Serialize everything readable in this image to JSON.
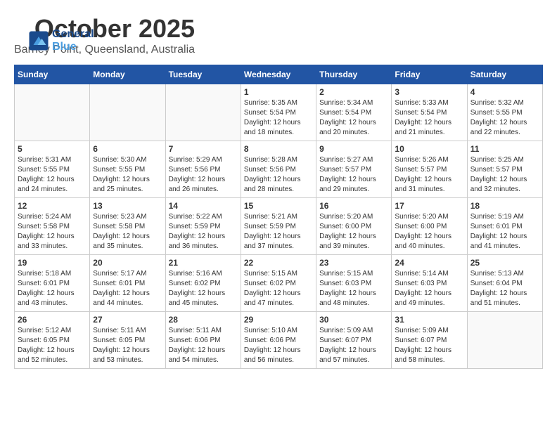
{
  "header": {
    "month_year": "October 2025",
    "location": "Barney Point, Queensland, Australia",
    "logo_line1": "General",
    "logo_line2": "Blue"
  },
  "weekdays": [
    "Sunday",
    "Monday",
    "Tuesday",
    "Wednesday",
    "Thursday",
    "Friday",
    "Saturday"
  ],
  "weeks": [
    [
      {
        "day": "",
        "sunrise": "",
        "sunset": "",
        "daylight": ""
      },
      {
        "day": "",
        "sunrise": "",
        "sunset": "",
        "daylight": ""
      },
      {
        "day": "",
        "sunrise": "",
        "sunset": "",
        "daylight": ""
      },
      {
        "day": "1",
        "sunrise": "Sunrise: 5:35 AM",
        "sunset": "Sunset: 5:54 PM",
        "daylight": "Daylight: 12 hours and 18 minutes."
      },
      {
        "day": "2",
        "sunrise": "Sunrise: 5:34 AM",
        "sunset": "Sunset: 5:54 PM",
        "daylight": "Daylight: 12 hours and 20 minutes."
      },
      {
        "day": "3",
        "sunrise": "Sunrise: 5:33 AM",
        "sunset": "Sunset: 5:54 PM",
        "daylight": "Daylight: 12 hours and 21 minutes."
      },
      {
        "day": "4",
        "sunrise": "Sunrise: 5:32 AM",
        "sunset": "Sunset: 5:55 PM",
        "daylight": "Daylight: 12 hours and 22 minutes."
      }
    ],
    [
      {
        "day": "5",
        "sunrise": "Sunrise: 5:31 AM",
        "sunset": "Sunset: 5:55 PM",
        "daylight": "Daylight: 12 hours and 24 minutes."
      },
      {
        "day": "6",
        "sunrise": "Sunrise: 5:30 AM",
        "sunset": "Sunset: 5:55 PM",
        "daylight": "Daylight: 12 hours and 25 minutes."
      },
      {
        "day": "7",
        "sunrise": "Sunrise: 5:29 AM",
        "sunset": "Sunset: 5:56 PM",
        "daylight": "Daylight: 12 hours and 26 minutes."
      },
      {
        "day": "8",
        "sunrise": "Sunrise: 5:28 AM",
        "sunset": "Sunset: 5:56 PM",
        "daylight": "Daylight: 12 hours and 28 minutes."
      },
      {
        "day": "9",
        "sunrise": "Sunrise: 5:27 AM",
        "sunset": "Sunset: 5:57 PM",
        "daylight": "Daylight: 12 hours and 29 minutes."
      },
      {
        "day": "10",
        "sunrise": "Sunrise: 5:26 AM",
        "sunset": "Sunset: 5:57 PM",
        "daylight": "Daylight: 12 hours and 31 minutes."
      },
      {
        "day": "11",
        "sunrise": "Sunrise: 5:25 AM",
        "sunset": "Sunset: 5:57 PM",
        "daylight": "Daylight: 12 hours and 32 minutes."
      }
    ],
    [
      {
        "day": "12",
        "sunrise": "Sunrise: 5:24 AM",
        "sunset": "Sunset: 5:58 PM",
        "daylight": "Daylight: 12 hours and 33 minutes."
      },
      {
        "day": "13",
        "sunrise": "Sunrise: 5:23 AM",
        "sunset": "Sunset: 5:58 PM",
        "daylight": "Daylight: 12 hours and 35 minutes."
      },
      {
        "day": "14",
        "sunrise": "Sunrise: 5:22 AM",
        "sunset": "Sunset: 5:59 PM",
        "daylight": "Daylight: 12 hours and 36 minutes."
      },
      {
        "day": "15",
        "sunrise": "Sunrise: 5:21 AM",
        "sunset": "Sunset: 5:59 PM",
        "daylight": "Daylight: 12 hours and 37 minutes."
      },
      {
        "day": "16",
        "sunrise": "Sunrise: 5:20 AM",
        "sunset": "Sunset: 6:00 PM",
        "daylight": "Daylight: 12 hours and 39 minutes."
      },
      {
        "day": "17",
        "sunrise": "Sunrise: 5:20 AM",
        "sunset": "Sunset: 6:00 PM",
        "daylight": "Daylight: 12 hours and 40 minutes."
      },
      {
        "day": "18",
        "sunrise": "Sunrise: 5:19 AM",
        "sunset": "Sunset: 6:01 PM",
        "daylight": "Daylight: 12 hours and 41 minutes."
      }
    ],
    [
      {
        "day": "19",
        "sunrise": "Sunrise: 5:18 AM",
        "sunset": "Sunset: 6:01 PM",
        "daylight": "Daylight: 12 hours and 43 minutes."
      },
      {
        "day": "20",
        "sunrise": "Sunrise: 5:17 AM",
        "sunset": "Sunset: 6:01 PM",
        "daylight": "Daylight: 12 hours and 44 minutes."
      },
      {
        "day": "21",
        "sunrise": "Sunrise: 5:16 AM",
        "sunset": "Sunset: 6:02 PM",
        "daylight": "Daylight: 12 hours and 45 minutes."
      },
      {
        "day": "22",
        "sunrise": "Sunrise: 5:15 AM",
        "sunset": "Sunset: 6:02 PM",
        "daylight": "Daylight: 12 hours and 47 minutes."
      },
      {
        "day": "23",
        "sunrise": "Sunrise: 5:15 AM",
        "sunset": "Sunset: 6:03 PM",
        "daylight": "Daylight: 12 hours and 48 minutes."
      },
      {
        "day": "24",
        "sunrise": "Sunrise: 5:14 AM",
        "sunset": "Sunset: 6:03 PM",
        "daylight": "Daylight: 12 hours and 49 minutes."
      },
      {
        "day": "25",
        "sunrise": "Sunrise: 5:13 AM",
        "sunset": "Sunset: 6:04 PM",
        "daylight": "Daylight: 12 hours and 51 minutes."
      }
    ],
    [
      {
        "day": "26",
        "sunrise": "Sunrise: 5:12 AM",
        "sunset": "Sunset: 6:05 PM",
        "daylight": "Daylight: 12 hours and 52 minutes."
      },
      {
        "day": "27",
        "sunrise": "Sunrise: 5:11 AM",
        "sunset": "Sunset: 6:05 PM",
        "daylight": "Daylight: 12 hours and 53 minutes."
      },
      {
        "day": "28",
        "sunrise": "Sunrise: 5:11 AM",
        "sunset": "Sunset: 6:06 PM",
        "daylight": "Daylight: 12 hours and 54 minutes."
      },
      {
        "day": "29",
        "sunrise": "Sunrise: 5:10 AM",
        "sunset": "Sunset: 6:06 PM",
        "daylight": "Daylight: 12 hours and 56 minutes."
      },
      {
        "day": "30",
        "sunrise": "Sunrise: 5:09 AM",
        "sunset": "Sunset: 6:07 PM",
        "daylight": "Daylight: 12 hours and 57 minutes."
      },
      {
        "day": "31",
        "sunrise": "Sunrise: 5:09 AM",
        "sunset": "Sunset: 6:07 PM",
        "daylight": "Daylight: 12 hours and 58 minutes."
      },
      {
        "day": "",
        "sunrise": "",
        "sunset": "",
        "daylight": ""
      }
    ]
  ]
}
